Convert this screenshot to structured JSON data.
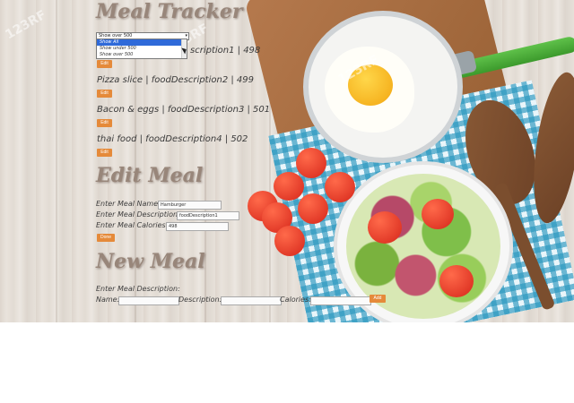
{
  "app": {
    "title": "Meal Tracker",
    "filter": {
      "selected": "Show over 500",
      "options": [
        "Show All",
        "Show under 500",
        "Show over 500"
      ],
      "highlighted_index": 0
    },
    "meals": [
      {
        "text": "Hamburger | foodDescription1 | 498",
        "visible_text": "scription1 | 498"
      },
      {
        "text": "Pizza slice | foodDescription2 | 499"
      },
      {
        "text": "Bacon & eggs | foodDescription3 | 501"
      },
      {
        "text": "thai food | foodDescription4 | 502"
      }
    ],
    "edit_button_label": "Edit"
  },
  "edit_meal": {
    "title": "Edit Meal",
    "name_label": "Enter Meal Name:",
    "name_value": "Hamburger",
    "description_label": "Enter Meal Description:",
    "description_value": "foodDescription1",
    "calories_label": "Enter Meal Calories:",
    "calories_value": "498",
    "done_label": "Done"
  },
  "new_meal": {
    "title": "New Meal",
    "intro_label": "Enter Meal Description:",
    "name_label": "Name:",
    "description_label": "Description:",
    "calories_label": "Calories:",
    "add_label": "Add"
  },
  "watermark": "123RF",
  "colors": {
    "accent_button": "#e58a3a",
    "heading": "#98867a",
    "dropdown_highlight": "#2f6ad9"
  }
}
